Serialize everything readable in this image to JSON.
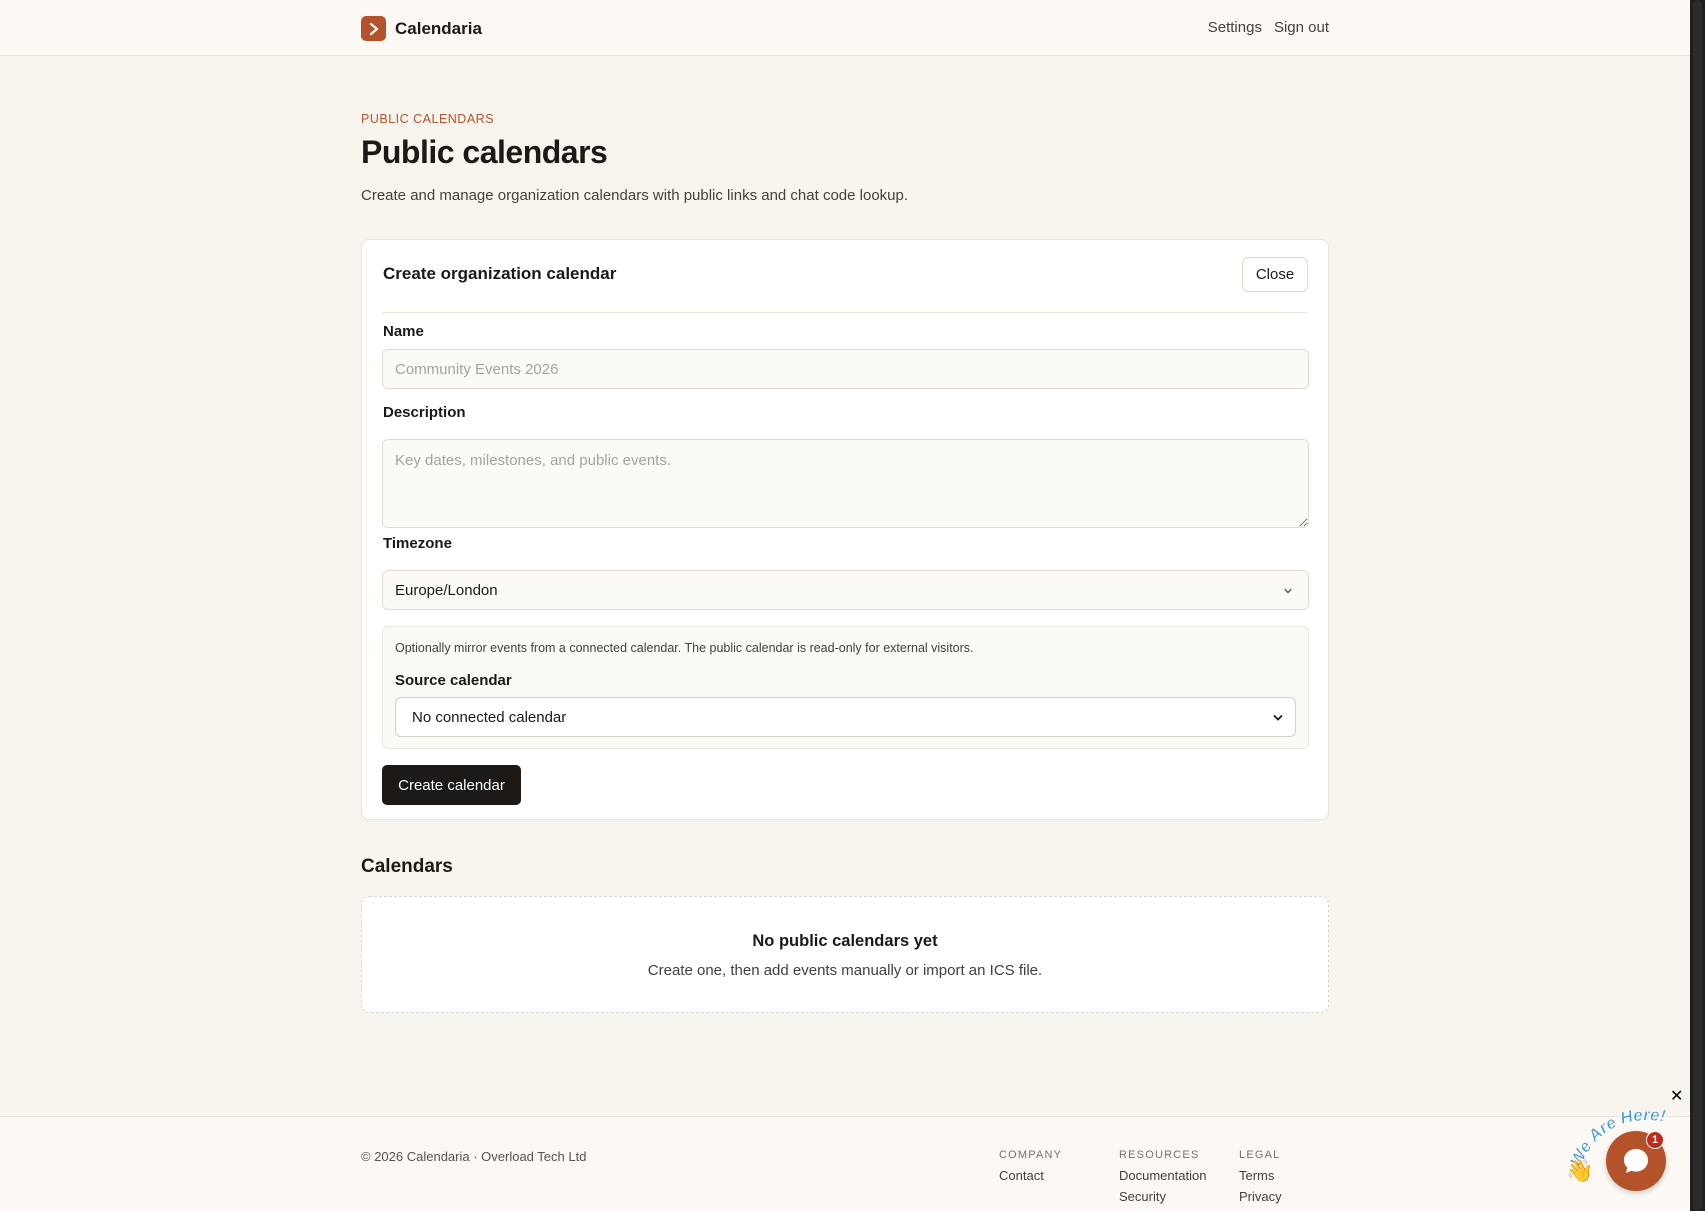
{
  "header": {
    "brand_name": "Calendaria",
    "nav": {
      "settings": "Settings",
      "sign_out": "Sign out"
    }
  },
  "page": {
    "eyebrow": "PUBLIC CALENDARS",
    "title": "Public calendars",
    "subtitle": "Create and manage organization calendars with public links and chat code lookup."
  },
  "form": {
    "title": "Create organization calendar",
    "close_label": "Close",
    "name_label": "Name",
    "name_placeholder": "Community Events 2026",
    "description_label": "Description",
    "description_placeholder": "Key dates, milestones, and public events.",
    "timezone_label": "Timezone",
    "timezone_value": "Europe/London",
    "mirror_note": "Optionally mirror events from a connected calendar. The public calendar is read-only for external visitors.",
    "source_label": "Source calendar",
    "source_value": "No connected calendar",
    "create_label": "Create calendar"
  },
  "calendars": {
    "title": "Calendars",
    "empty_title": "No public calendars yet",
    "empty_subtitle": "Create one, then add events manually or import an ICS file."
  },
  "footer": {
    "copyright": "© 2026 Calendaria · Overload Tech Ltd",
    "columns": [
      {
        "heading": "COMPANY",
        "links": [
          "Contact"
        ]
      },
      {
        "heading": "RESOURCES",
        "links": [
          "Documentation",
          "Security"
        ]
      },
      {
        "heading": "LEGAL",
        "links": [
          "Terms",
          "Privacy"
        ]
      }
    ]
  },
  "widget": {
    "arc_text": "We Are Here!",
    "badge_count": "1",
    "close_glyph": "✕"
  },
  "colors": {
    "accent": "#b4532a",
    "background": "#f8f4ee",
    "primary_button": "#1c1917"
  },
  "icons": {
    "brand": "chevron-right-icon",
    "timezone": "chevron-down-icon",
    "source": "chevron-down-icon",
    "chat": "chat-bubble-icon",
    "wave": "waving-hand-icon"
  }
}
